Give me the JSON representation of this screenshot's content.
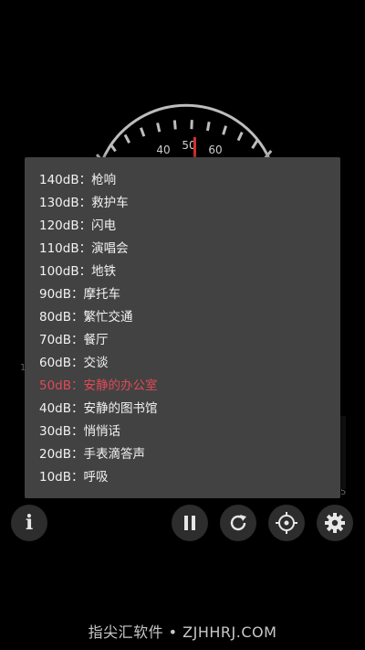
{
  "gauge": {
    "tick_labels": [
      "40",
      "50",
      "60"
    ],
    "side_labels": [
      "1",
      "5"
    ]
  },
  "popup": {
    "items": [
      {
        "label": "140dB：枪响",
        "current": false
      },
      {
        "label": "130dB：救护车",
        "current": false
      },
      {
        "label": "120dB：闪电",
        "current": false
      },
      {
        "label": "110dB：演唱会",
        "current": false
      },
      {
        "label": "100dB：地铁",
        "current": false
      },
      {
        "label": "90dB：摩托车",
        "current": false
      },
      {
        "label": "80dB：繁忙交通",
        "current": false
      },
      {
        "label": "70dB：餐厅",
        "current": false
      },
      {
        "label": "60dB：交谈",
        "current": false
      },
      {
        "label": "50dB：安静的办公室",
        "current": true
      },
      {
        "label": "40dB：安静的图书馆",
        "current": false
      },
      {
        "label": "30dB：悄悄话",
        "current": false
      },
      {
        "label": "20dB：手表滴答声",
        "current": false
      },
      {
        "label": "10dB：呼吸",
        "current": false
      }
    ],
    "highlight_color": "#e04a56"
  },
  "toolbar": {
    "info_label": "i",
    "buttons": [
      {
        "name": "info",
        "icon": "info-icon"
      },
      {
        "name": "pause",
        "icon": "pause-icon"
      },
      {
        "name": "refresh",
        "icon": "refresh-icon"
      },
      {
        "name": "calibrate",
        "icon": "crosshair-icon"
      },
      {
        "name": "settings",
        "icon": "gear-icon"
      }
    ]
  },
  "watermark": "指尖汇软件 • ZJHHRJ.COM"
}
